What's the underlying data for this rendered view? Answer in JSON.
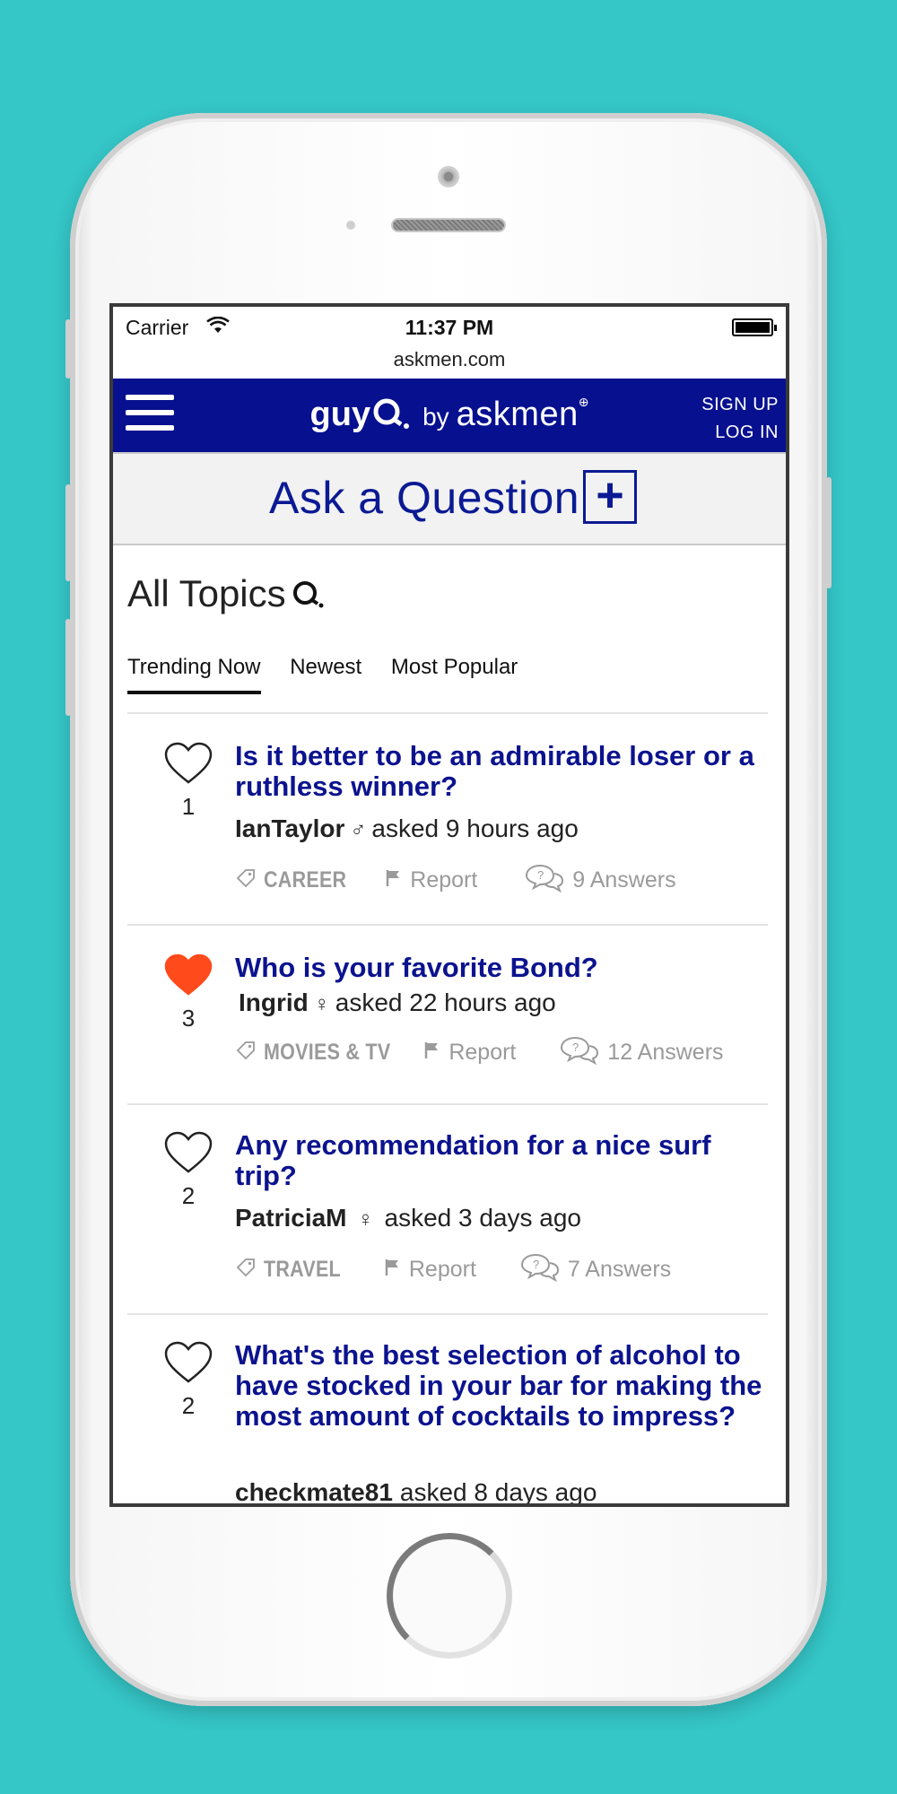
{
  "status_bar": {
    "carrier": "Carrier",
    "time": "11:37 PM"
  },
  "browser": {
    "url": "askmen.com"
  },
  "header": {
    "logo_guy": "guy",
    "logo_by": "by",
    "logo_brand": "askmen",
    "sign_up": "SIGN UP",
    "log_in": "LOG IN",
    "brand_color": "#07108f"
  },
  "ask": {
    "label": "Ask a Question",
    "plus": "+"
  },
  "topics": {
    "title": "All Topics"
  },
  "tabs": [
    {
      "label": "Trending Now",
      "active": true
    },
    {
      "label": "Newest",
      "active": false
    },
    {
      "label": "Most Popular",
      "active": false
    }
  ],
  "questions": [
    {
      "likes": "1",
      "liked": false,
      "title": "Is it better to be an admirable loser or a ruthless winner?",
      "user": "IanTaylor",
      "gender": "♂",
      "asked": "asked 9 hours ago",
      "tag": "CAREER",
      "report": "Report",
      "answers": "9 Answers"
    },
    {
      "likes": "3",
      "liked": true,
      "title": "Who is your favorite Bond?",
      "user": "Ingrid",
      "gender": "♀",
      "asked": "asked 22 hours ago",
      "tag": "MOVIES & TV",
      "report": "Report",
      "answers": "12 Answers"
    },
    {
      "likes": "2",
      "liked": false,
      "title": "Any recommendation for a nice surf trip?",
      "user": "PatriciaM",
      "gender": "♀",
      "asked": "asked 3 days ago",
      "tag": "TRAVEL",
      "report": "Report",
      "answers": "7 Answers"
    },
    {
      "likes": "2",
      "liked": false,
      "title": "What's the best selection of alcohol to have stocked in your bar for making the most amount of cocktails to impress?",
      "user": "checkmate81",
      "gender": "",
      "asked": "asked 8 days ago"
    }
  ],
  "colors": {
    "background": "#35c6c7",
    "liked_heart": "#ff4a1c",
    "title": "#0c138e"
  }
}
